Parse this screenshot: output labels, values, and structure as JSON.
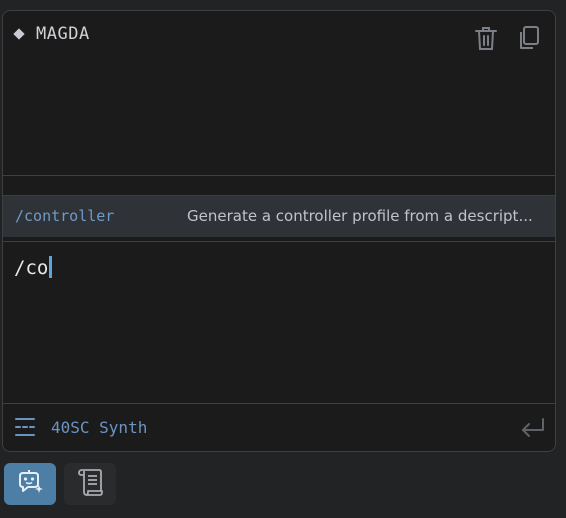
{
  "agent": {
    "name": "MAGDA"
  },
  "header": {
    "icons": [
      "trash-icon",
      "copy-icon"
    ]
  },
  "suggestion": {
    "command": "/controller",
    "description": "Generate a controller profile from a descript..."
  },
  "input": {
    "value": "/co"
  },
  "footer": {
    "synth_label": "40SC Synth",
    "icons": [
      "list-icon",
      "enter-icon"
    ]
  },
  "tabs": [
    {
      "name": "agent",
      "icon": "robot-chat-icon",
      "active": true
    },
    {
      "name": "log",
      "icon": "scroll-icon",
      "active": false
    }
  ],
  "colors": {
    "accent": "#4d7fa6",
    "command_text": "#6e9bc8",
    "cursor": "#5aa7e0",
    "panel_bg": "#1b1b1c",
    "page_bg": "#222325",
    "suggestion_bg": "#2f3338"
  }
}
